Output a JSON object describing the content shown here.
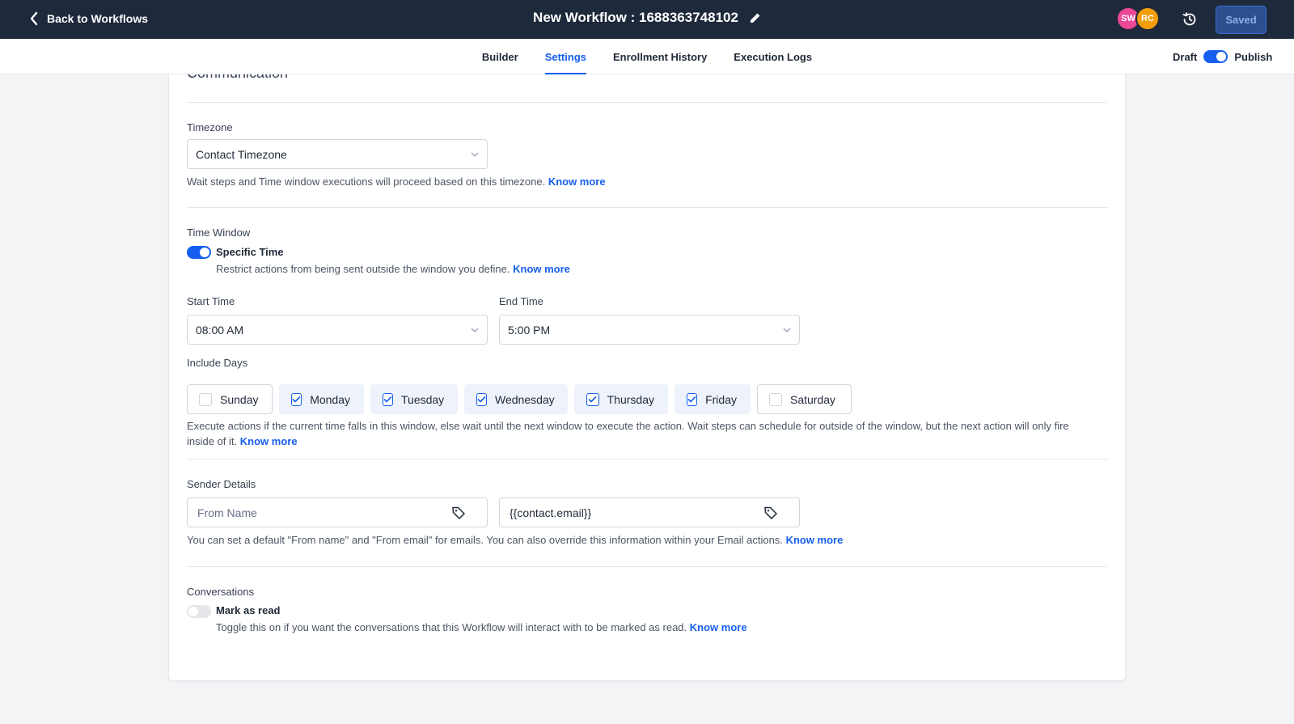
{
  "header": {
    "back_label": "Back to Workflows",
    "title": "New Workflow : 1688363748102",
    "avatars": [
      {
        "initials": "SW",
        "color": "#ec4899"
      },
      {
        "initials": "RC",
        "color": "#f59e0b"
      }
    ],
    "saved_label": "Saved"
  },
  "tabs": [
    {
      "label": "Builder"
    },
    {
      "label": "Settings"
    },
    {
      "label": "Enrollment History"
    },
    {
      "label": "Execution Logs"
    }
  ],
  "active_tab": "Settings",
  "publish": {
    "draft_label": "Draft",
    "publish_label": "Publish",
    "published": true
  },
  "settings": {
    "section_title": "Communication",
    "timezone": {
      "label": "Timezone",
      "value": "Contact Timezone",
      "help": "Wait steps and Time window executions will proceed based on this timezone.",
      "link": "Know more"
    },
    "time_window": {
      "label": "Time Window",
      "toggle_label": "Specific Time",
      "enabled": true,
      "help": "Restrict actions from being sent outside the window you define.",
      "link": "Know more",
      "start_label": "Start Time",
      "start_value": "08:00 AM",
      "end_label": "End Time",
      "end_value": "5:00 PM",
      "days_label": "Include Days",
      "days": [
        {
          "label": "Sunday",
          "checked": false
        },
        {
          "label": "Monday",
          "checked": true
        },
        {
          "label": "Tuesday",
          "checked": true
        },
        {
          "label": "Wednesday",
          "checked": true
        },
        {
          "label": "Thursday",
          "checked": true
        },
        {
          "label": "Friday",
          "checked": true
        },
        {
          "label": "Saturday",
          "checked": false
        }
      ],
      "days_help": "Execute actions if the current time falls in this window, else wait until the next window to execute the action. Wait steps can schedule for outside of the window, but the next action will only fire inside of it.",
      "days_link": "Know more"
    },
    "sender": {
      "label": "Sender Details",
      "from_name_placeholder": "From Name",
      "from_email_value": "{{contact.email}}",
      "help": "You can set a default \"From name\" and \"From email\" for emails. You can also override this information within your Email actions.",
      "link": "Know more"
    },
    "conversations": {
      "label": "Conversations",
      "toggle_label": "Mark as read",
      "enabled": false,
      "help": "Toggle this on if you want the conversations that this Workflow will interact with to be marked as read.",
      "link": "Know more"
    }
  },
  "colors": {
    "header_bg": "#1e293b",
    "accent": "#155eef",
    "page_bg": "#f3f4f6"
  },
  "icons": [
    "chevron-left-icon",
    "pencil-icon",
    "history-icon",
    "chevron-down-icon",
    "check-icon",
    "tag-icon"
  ]
}
